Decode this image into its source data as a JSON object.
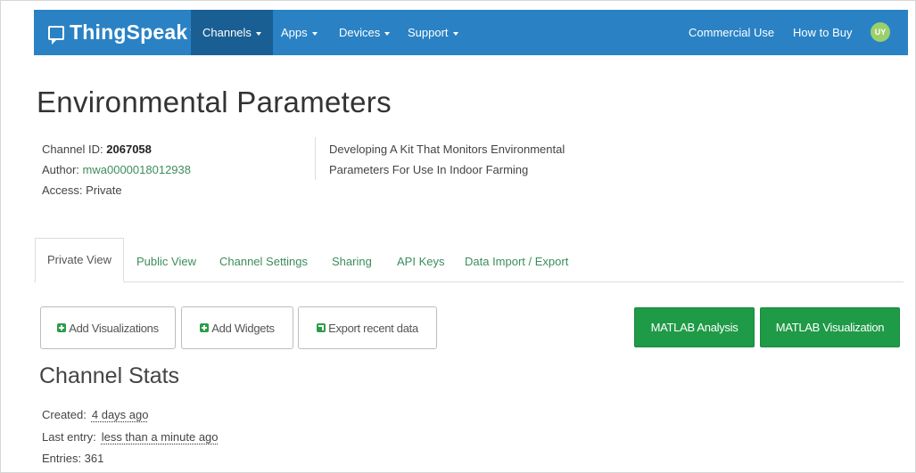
{
  "navbar": {
    "brand": "ThingSpeak",
    "brand_tm": "™",
    "items": [
      {
        "label": "Channels",
        "dropdown": true,
        "active": true
      },
      {
        "label": "Apps",
        "dropdown": true
      },
      {
        "label": "Devices",
        "dropdown": true
      },
      {
        "label": "Support",
        "dropdown": true
      }
    ],
    "right_items": [
      "Commercial Use",
      "How to Buy"
    ],
    "avatar_initials": "UY",
    "colors": {
      "bar": "#2a82c5",
      "active": "#1a5f93",
      "avatar": "#9bcf6b"
    }
  },
  "page": {
    "title": "Environmental Parameters",
    "channel_id_label": "Channel ID:",
    "channel_id": "2067058",
    "author_label": "Author:",
    "author": "mwa0000018012938",
    "access": "Access: Private",
    "description_line1": "Developing A Kit That Monitors Environmental",
    "description_line2": "Parameters For Use In Indoor Farming"
  },
  "tabs": [
    "Private View",
    "Public View",
    "Channel Settings",
    "Sharing",
    "API Keys",
    "Data Import / Export"
  ],
  "active_tab": "Private View",
  "actions": {
    "add_visualizations": "Add Visualizations",
    "add_widgets": "Add Widgets",
    "export_recent_data": "Export recent data",
    "matlab_analysis": "MATLAB Analysis",
    "matlab_visualization": "MATLAB Visualization",
    "green": "#1f9a47"
  },
  "stats": {
    "title": "Channel Stats",
    "created_label": "Created:",
    "created_value": "4 days ago",
    "last_entry_label": "Last entry:",
    "last_entry_value": "less than a minute ago",
    "entries": "Entries: 361"
  }
}
